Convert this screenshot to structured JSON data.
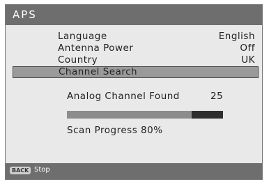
{
  "header": {
    "title": "APS"
  },
  "menu": {
    "items": [
      {
        "label": "Language",
        "value": "English"
      },
      {
        "label": "Antenna Power",
        "value": "Off"
      },
      {
        "label": "Country",
        "value": "UK"
      },
      {
        "label": "Channel Search",
        "value": ""
      }
    ],
    "selected_index": 3
  },
  "scan": {
    "found_label": "Analog Channel Found",
    "found_value": "25",
    "progress_label": "Scan Progress",
    "progress_percent": 80,
    "progress_text": "80%"
  },
  "footer": {
    "back_key": "BACK",
    "back_action": "Stop"
  },
  "colors": {
    "header_bg": "#6e6e6e",
    "panel_bg": "#e9e9e9",
    "selected_bg": "#9a9a9a",
    "bar_track": "#2e2e2e",
    "bar_fill": "#8c8c8c"
  }
}
